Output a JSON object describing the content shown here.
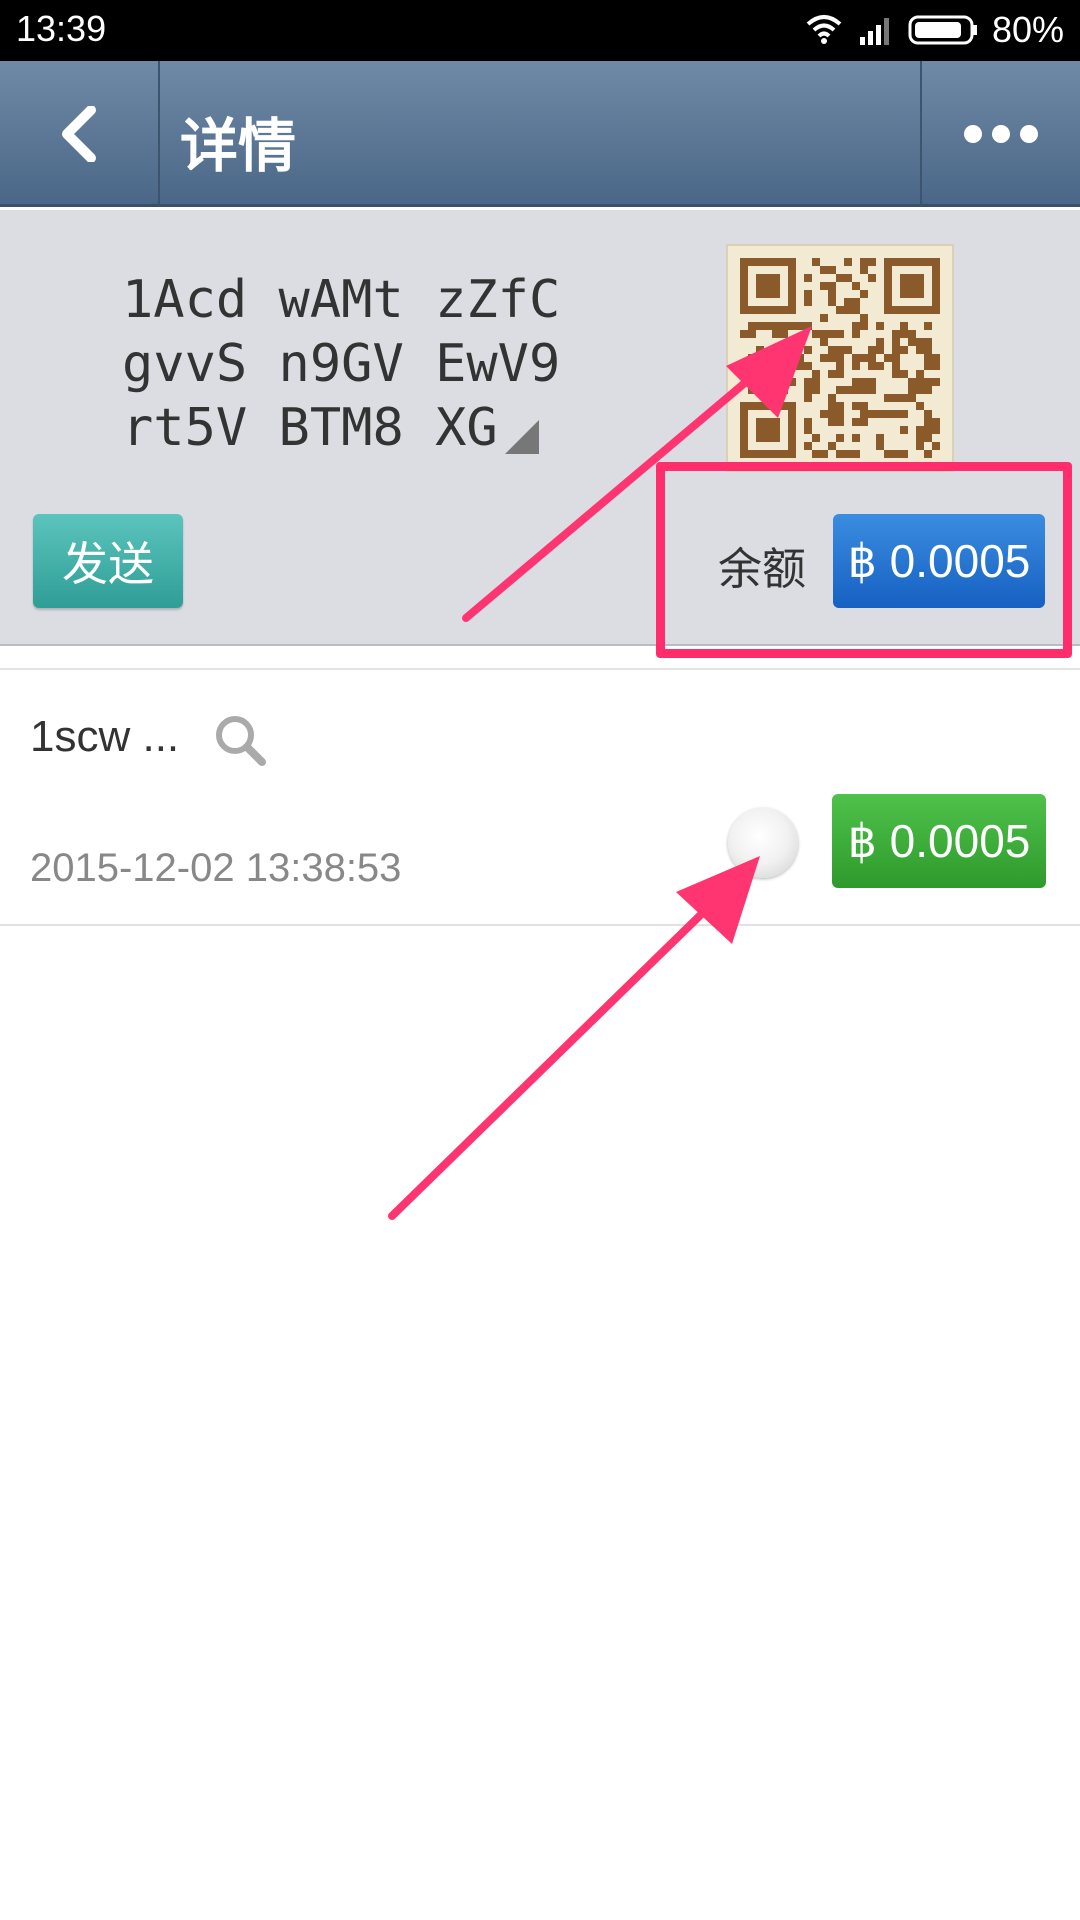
{
  "status_bar": {
    "time": "13:39",
    "battery_percent": "80%"
  },
  "title_bar": {
    "title": "详情"
  },
  "wallet": {
    "address_lines": [
      "1Acd wAMt zZfC",
      "gvvS n9GV EwV9",
      "rt5V BTM8 XG"
    ],
    "send_label": "发送",
    "balance_label": "余额",
    "balance_value": "฿ 0.0005"
  },
  "transactions": [
    {
      "address": "1scw ...",
      "date": "2015-12-02 13:38:53",
      "amount": "฿ 0.0005"
    }
  ],
  "colors": {
    "highlight": "#ff2d6b",
    "balance_btn": "#1e6fd0",
    "amount_btn": "#3aae36",
    "send_btn": "#3fb1a9"
  }
}
